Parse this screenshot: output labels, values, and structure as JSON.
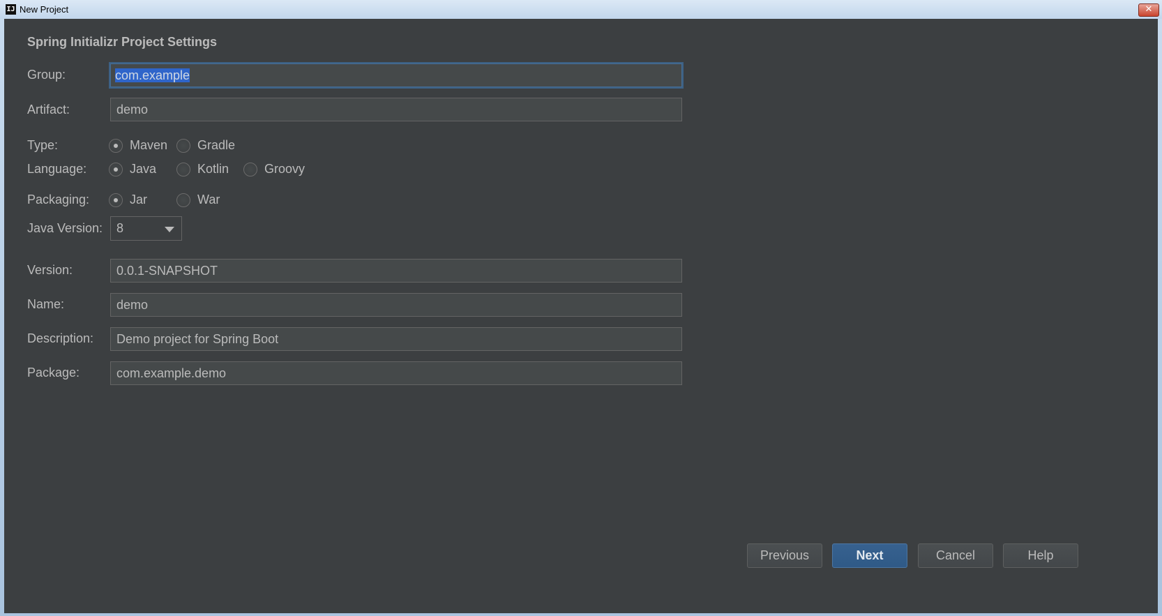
{
  "window": {
    "title": "New Project",
    "app_icon_glyph": "IJ",
    "close_glyph": "✕"
  },
  "heading": "Spring Initializr Project Settings",
  "group": {
    "label": "Group:",
    "value": "com.example"
  },
  "artifact": {
    "label": "Artifact:",
    "value": "demo"
  },
  "type": {
    "label": "Type:",
    "options": [
      "Maven",
      "Gradle"
    ],
    "selected": "Maven"
  },
  "language": {
    "label": "Language:",
    "options": [
      "Java",
      "Kotlin",
      "Groovy"
    ],
    "selected": "Java"
  },
  "packaging": {
    "label": "Packaging:",
    "options": [
      "Jar",
      "War"
    ],
    "selected": "Jar"
  },
  "java_version": {
    "label": "Java Version:",
    "value": "8"
  },
  "version": {
    "label": "Version:",
    "value": "0.0.1-SNAPSHOT"
  },
  "name": {
    "label": "Name:",
    "value": "demo"
  },
  "description": {
    "label": "Description:",
    "value": "Demo project for Spring Boot"
  },
  "package": {
    "label": "Package:",
    "value": "com.example.demo"
  },
  "buttons": {
    "previous": "Previous",
    "next": "Next",
    "cancel": "Cancel",
    "help": "Help"
  },
  "colors": {
    "background": "#3c3f41",
    "field": "#45494a",
    "text": "#bbbbbb",
    "accent": "#2f65ca",
    "default_button": "#365f8c"
  }
}
